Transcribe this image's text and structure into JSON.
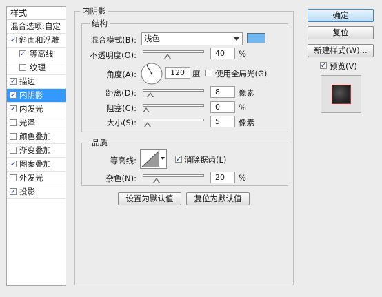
{
  "sidebar": {
    "header": "样式",
    "blend_options": "混合选项:自定",
    "items": [
      {
        "label": "斜面和浮雕",
        "checked": true,
        "sub": false,
        "selected": false
      },
      {
        "label": "等高线",
        "checked": true,
        "sub": true,
        "selected": false
      },
      {
        "label": "纹理",
        "checked": false,
        "sub": true,
        "selected": false
      },
      {
        "label": "描边",
        "checked": true,
        "sub": false,
        "selected": false
      },
      {
        "label": "内阴影",
        "checked": true,
        "sub": false,
        "selected": true
      },
      {
        "label": "内发光",
        "checked": true,
        "sub": false,
        "selected": false
      },
      {
        "label": "光泽",
        "checked": false,
        "sub": false,
        "selected": false
      },
      {
        "label": "颜色叠加",
        "checked": false,
        "sub": false,
        "selected": false
      },
      {
        "label": "渐变叠加",
        "checked": false,
        "sub": false,
        "selected": false
      },
      {
        "label": "图案叠加",
        "checked": true,
        "sub": false,
        "selected": false
      },
      {
        "label": "外发光",
        "checked": false,
        "sub": false,
        "selected": false
      },
      {
        "label": "投影",
        "checked": true,
        "sub": false,
        "selected": false
      }
    ]
  },
  "panel": {
    "title": "内阴影",
    "structure": {
      "legend": "结构",
      "blend_mode_label": "混合模式(B):",
      "blend_mode_value": "浅色",
      "blend_color": "#6fb8f2",
      "opacity_label": "不透明度(O):",
      "opacity_value": "40",
      "opacity_unit": "%",
      "opacity_level": 0.4,
      "angle_label": "角度(A):",
      "angle_value": "120",
      "angle_unit": "度",
      "global_light_label": "使用全局光(G)",
      "global_light_checked": false,
      "distance_label": "距离(D):",
      "distance_value": "8",
      "distance_unit": "像素",
      "distance_level": 0.08,
      "choke_label": "阻塞(C):",
      "choke_value": "0",
      "choke_unit": "%",
      "choke_level": 0.0,
      "size_label": "大小(S):",
      "size_value": "5",
      "size_unit": "像素",
      "size_level": 0.02
    },
    "quality": {
      "legend": "品质",
      "contour_label": "等高线:",
      "antialias_label": "消除锯齿(L)",
      "antialias_checked": true,
      "noise_label": "杂色(N):",
      "noise_value": "20",
      "noise_unit": "%",
      "noise_level": 0.2
    },
    "set_default": "设置为默认值",
    "reset_default": "复位为默认值"
  },
  "actions": {
    "ok": "确定",
    "reset": "复位",
    "new_style": "新建样式(W)...",
    "preview_label": "预览(V)",
    "preview_checked": true
  }
}
